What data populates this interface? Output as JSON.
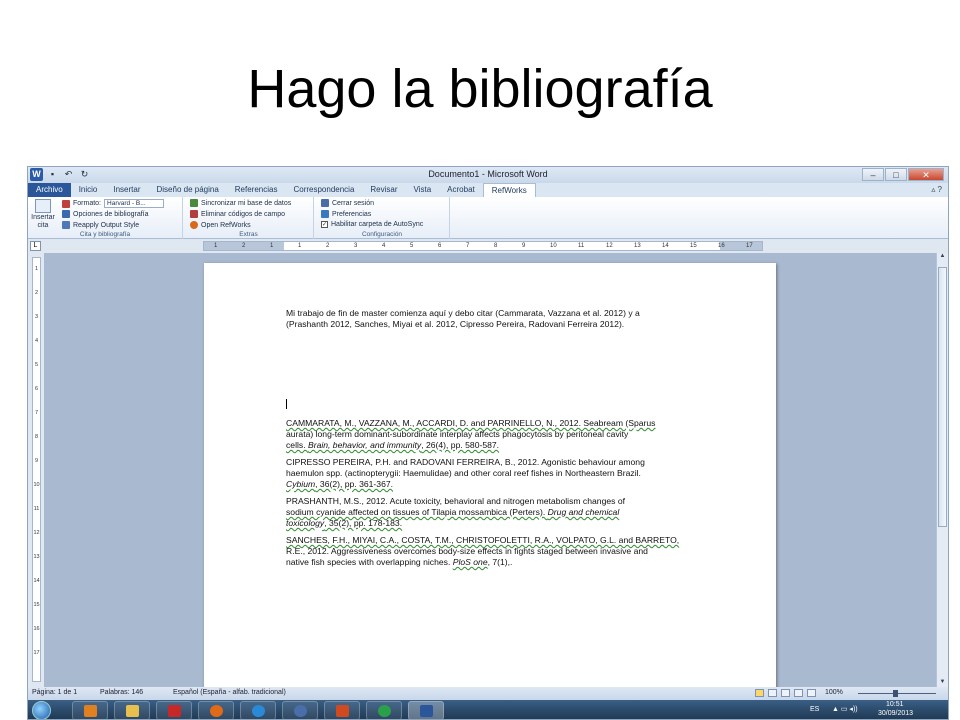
{
  "slide": {
    "title": "Hago la bibliografía"
  },
  "window": {
    "title": "Documento1 - Microsoft Word",
    "controls": {
      "minimize": "–",
      "maximize": "□",
      "close": "✕"
    }
  },
  "tabs": [
    "Archivo",
    "Inicio",
    "Insertar",
    "Diseño de página",
    "Referencias",
    "Correspondencia",
    "Revisar",
    "Vista",
    "Acrobat",
    "RefWorks"
  ],
  "ribbon": {
    "insert_citation": "Insertar cita",
    "format_label": "Formato:",
    "format_value": "Harvard - B...",
    "bib_options": "Opciones de bibliografía",
    "reapply": "Reapply Output Style",
    "group1_label": "Cita y bibliografía",
    "sync": "Sincronizar mi base de datos",
    "remove_codes": "Eliminar códigos de campo",
    "open_refworks": "Open RefWorks",
    "group2_label": "Extras",
    "logout": "Cerrar sesión",
    "preferences": "Preferencias",
    "autosync": "Habilitar carpeta de AutoSync",
    "group3_label": "Configuración"
  },
  "document": {
    "intro_line1": "Mi trabajo de fin de master comienza aquí y debo citar (Cammarata, Vazzana et al. 2012)  y a",
    "intro_line2": "(Prashanth 2012, Sanches, Miyai et al. 2012, Cipresso Pereira, Radovani Ferreira 2012).",
    "ref1_l1": "CAMMARATA, M., VAZZANA, M., ACCARDI, D. and PARRINELLO, N., 2012. Seabream (Sparus",
    "ref1_l2": "aurata) long-term dominant-subordinate interplay affects phagocytosis by peritoneal cavity",
    "ref1_l3a": "cells. ",
    "ref1_l3b": "Brain, behavior, and immunity",
    "ref1_l3c": ", 26(4), pp. 580-587.",
    "ref2_l1": "CIPRESSO PEREIRA, P.H. and RADOVANI FERREIRA, B., 2012. Agonistic behaviour among",
    "ref2_l2": "haemulon spp. (actinopterygii: Haemulidae) and other coral reef fishes in Northeastern Brazil.",
    "ref2_l3a": "Cybium",
    "ref2_l3b": ", 36(2), pp. 361-367.",
    "ref3_l1": "PRASHANTH, M.S., 2012. Acute toxicity, behavioral and nitrogen metabolism changes of",
    "ref3_l2": "sodium cyanide affected on tissues of Tilapia mossambica (Perters). ",
    "ref3_l2b": "Drug and chemical",
    "ref3_l3a": "toxicology",
    "ref3_l3b": ", 35(2), pp. 178-183.",
    "ref4_l1": "SANCHES, F.H., MIYAI, C.A., COSTA, T.M., CHRISTOFOLETTI, R.A., VOLPATO, G.L. and BARRETO,",
    "ref4_l2": "R.E., 2012.  Aggressiveness overcomes body-size effects in fights staged between invasive and",
    "ref4_l3a": "native fish species with overlapping niches. ",
    "ref4_l3b": "PloS one",
    "ref4_l3c": ", 7(1),."
  },
  "ruler": {
    "h_ticks": [
      "1",
      "2",
      "1",
      "1",
      "2",
      "3",
      "4",
      "5",
      "6",
      "7",
      "8",
      "9",
      "10",
      "11",
      "12",
      "13",
      "14",
      "15",
      "16",
      "17"
    ],
    "v_ticks": [
      "1",
      "2",
      "3",
      "4",
      "5",
      "6",
      "7",
      "8",
      "9",
      "10",
      "11",
      "12",
      "13",
      "14",
      "15",
      "16",
      "17"
    ]
  },
  "status": {
    "page": "Página: 1 de 1",
    "words": "Palabras: 146",
    "language": "Español (España - alfab. tradicional)",
    "zoom": "100%"
  },
  "taskbar": {
    "lang": "ES",
    "time": "10:51",
    "date": "30/09/2013"
  },
  "colors": {
    "accent": "#2b579a",
    "page_bg": "#ffffff",
    "workspace": "#a9b9cf"
  }
}
